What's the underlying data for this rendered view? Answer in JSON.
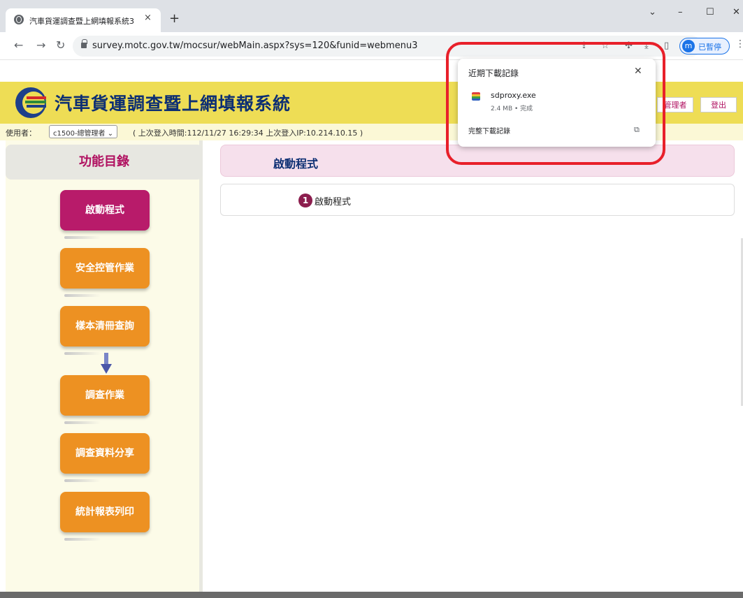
{
  "browser": {
    "tab_title": "汽車貨運調查暨上網填報系統3",
    "tab_close": "×",
    "new_tab": "+",
    "win_minimize": "–",
    "win_maximize": "☐",
    "win_close": "✕",
    "win_tabsearch": "⌄",
    "url": "survey.motc.gov.tw/mocsur/webMain.aspx?sys=120&funid=webmenu3",
    "profile_initial": "m",
    "profile_status": "已暫停"
  },
  "downloads": {
    "title": "近期下載記錄",
    "file_name": "sdproxy.exe",
    "file_meta": "2.4 MB • 完成",
    "all_label": "完整下載記錄"
  },
  "header": {
    "site_title": "汽車貨運調查暨上網填報系統",
    "admin_label": "管理者",
    "logout_label": "登出"
  },
  "userbar": {
    "label": "使用者：",
    "user_select": "c1500-總管理者 ⌄",
    "login_info": "( 上次登入時間:112/11/27 16:29:34 上次登入IP:10.214.10.15 )"
  },
  "sidebar": {
    "title": "功能目錄",
    "items": [
      {
        "label": "啟動程式",
        "active": true
      },
      {
        "label": "安全控管作業",
        "active": false
      },
      {
        "label": "樣本清冊查詢",
        "active": false
      },
      {
        "label": "調查作業",
        "active": false
      },
      {
        "label": "調查資料分享",
        "active": false
      },
      {
        "label": "統計報表列印",
        "active": false
      }
    ]
  },
  "main": {
    "title": "啟動程式",
    "step_number": "1",
    "step_label": "啟動程式"
  },
  "colors": {
    "header_yellow": "#eedd55",
    "menu_orange": "#ed9122",
    "menu_active": "#b81b6a",
    "title_blue": "#0d2f73",
    "highlight_red": "#e8202a"
  }
}
